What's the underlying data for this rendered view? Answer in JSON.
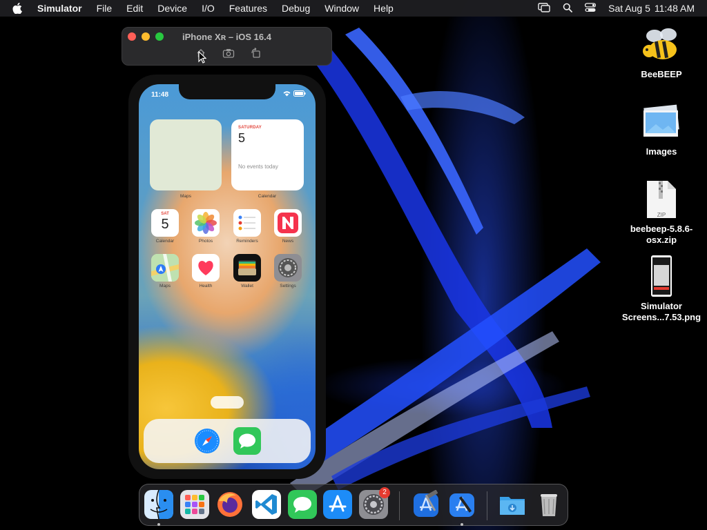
{
  "menubar": {
    "app_name": "Simulator",
    "items": [
      "File",
      "Edit",
      "Device",
      "I/O",
      "Features",
      "Debug",
      "Window",
      "Help"
    ],
    "date": "Sat Aug 5",
    "time": "11:48 AM"
  },
  "simulator_window": {
    "title": "iPhone Xʀ – iOS 16.4",
    "toolbar": [
      "home-icon",
      "screenshot-icon",
      "rotate-icon"
    ]
  },
  "phone": {
    "status_time": "11:48",
    "widgets": {
      "maps_label": "Maps",
      "calendar_label": "Calendar",
      "calendar_day": "SATURDAY",
      "calendar_date": "5",
      "calendar_events": "No events today"
    },
    "apps_row1": [
      {
        "label": "Calendar",
        "day": "SAT",
        "date": "5"
      },
      {
        "label": "Photos"
      },
      {
        "label": "Reminders"
      },
      {
        "label": "News"
      }
    ],
    "apps_row2": [
      {
        "label": "Maps"
      },
      {
        "label": "Health"
      },
      {
        "label": "Wallet"
      },
      {
        "label": "Settings"
      }
    ],
    "dock_apps": [
      "safari-icon",
      "messages-icon"
    ]
  },
  "desktop_icons": [
    {
      "label": "BeeBEEP"
    },
    {
      "label": "Images"
    },
    {
      "label": "beebeep-5.8.6-osx.zip",
      "badge": "ZIP"
    },
    {
      "label": "Simulator Screens...7.53.png"
    }
  ],
  "dock": {
    "apps": [
      "finder-icon",
      "launchpad-icon",
      "firefox-icon",
      "vscode-icon",
      "messages-icon",
      "app-store-icon",
      "system-settings-icon",
      "xcode-icon",
      "xcode-instruments-icon",
      "downloads-folder-icon",
      "trash-icon"
    ],
    "settings_badge": "2"
  },
  "colors": {
    "menubar_bg": "#1e1e22",
    "traffic_red": "#ff5f57",
    "traffic_yellow": "#febc2e",
    "traffic_green": "#28c840",
    "accent_blue": "#2450ff"
  }
}
